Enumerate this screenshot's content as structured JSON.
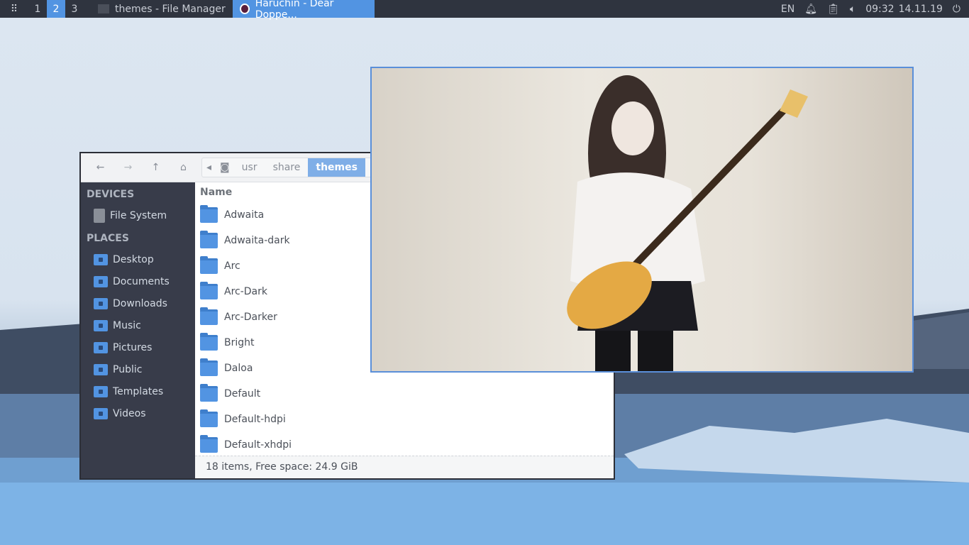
{
  "panel": {
    "workspaces": [
      "1",
      "2",
      "3"
    ],
    "active_workspace": "2",
    "tasks": [
      {
        "title": "themes - File Manager",
        "icon": "folder-icon"
      },
      {
        "title": "Haruchin - Dear Doppe...",
        "icon": "media-player-icon",
        "active": true
      }
    ],
    "keyboard_layout": "EN",
    "time": "09:32",
    "date": "14.11.19"
  },
  "file_manager": {
    "breadcrumb": [
      "usr",
      "share",
      "themes"
    ],
    "sidebar": {
      "devices_label": "DEVICES",
      "devices": [
        "File System"
      ],
      "places_label": "PLACES",
      "places": [
        "Desktop",
        "Documents",
        "Downloads",
        "Music",
        "Pictures",
        "Public",
        "Templates",
        "Videos"
      ]
    },
    "column_name": "Name",
    "items": [
      "Adwaita",
      "Adwaita-dark",
      "Arc",
      "Arc-Dark",
      "Arc-Darker",
      "Bright",
      "Daloa",
      "Default",
      "Default-hdpi",
      "Default-xhdpi"
    ],
    "status": "18 items, Free space: 24.9 GiB"
  },
  "colors": {
    "accent": "#5294e2",
    "panel": "#2f343f",
    "sidebar": "#383c4a"
  }
}
